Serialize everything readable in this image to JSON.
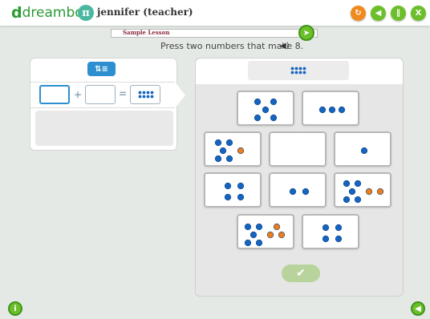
{
  "header": {
    "brand": "dreambox",
    "brand_mark": "d",
    "avatar_symbol": "π",
    "user_name": "jennifer (teacher)",
    "buttons": [
      {
        "name": "refresh",
        "icon": "refresh-icon"
      },
      {
        "name": "sound",
        "icon": "speaker-icon"
      },
      {
        "name": "pause",
        "icon": "pause-icon"
      },
      {
        "name": "exit",
        "icon": "close-icon"
      }
    ]
  },
  "banner": {
    "title": "Sample Lesson",
    "next_icon": "next-arrow-icon"
  },
  "instruction": {
    "text": "Press two numbers that make 8.",
    "speaker_icon": "speaker-icon"
  },
  "equation": {
    "plus": "+",
    "equals": "=",
    "sort_icon": "sort-icon",
    "target_dots": 8
  },
  "cards": [
    {
      "blue": 5,
      "orange": 0
    },
    {
      "blue": 3,
      "orange": 0
    },
    {
      "blue": 5,
      "orange": 1
    },
    {
      "blue": 0,
      "orange": 0
    },
    {
      "blue": 1,
      "orange": 0
    },
    {
      "blue": 4,
      "orange": 0
    },
    {
      "blue": 2,
      "orange": 0
    },
    {
      "blue": 5,
      "orange": 2
    },
    {
      "blue": 5,
      "orange": 3
    },
    {
      "blue": 4,
      "orange": 0
    }
  ],
  "colors": {
    "blue_dot": "#1565c0",
    "orange_dot": "#ef7d1a",
    "brand_green": "#2b9a33",
    "accent_blue": "#2d8fd0"
  },
  "footer": {
    "info_icon": "info-icon",
    "mute_icon": "mute-icon"
  }
}
